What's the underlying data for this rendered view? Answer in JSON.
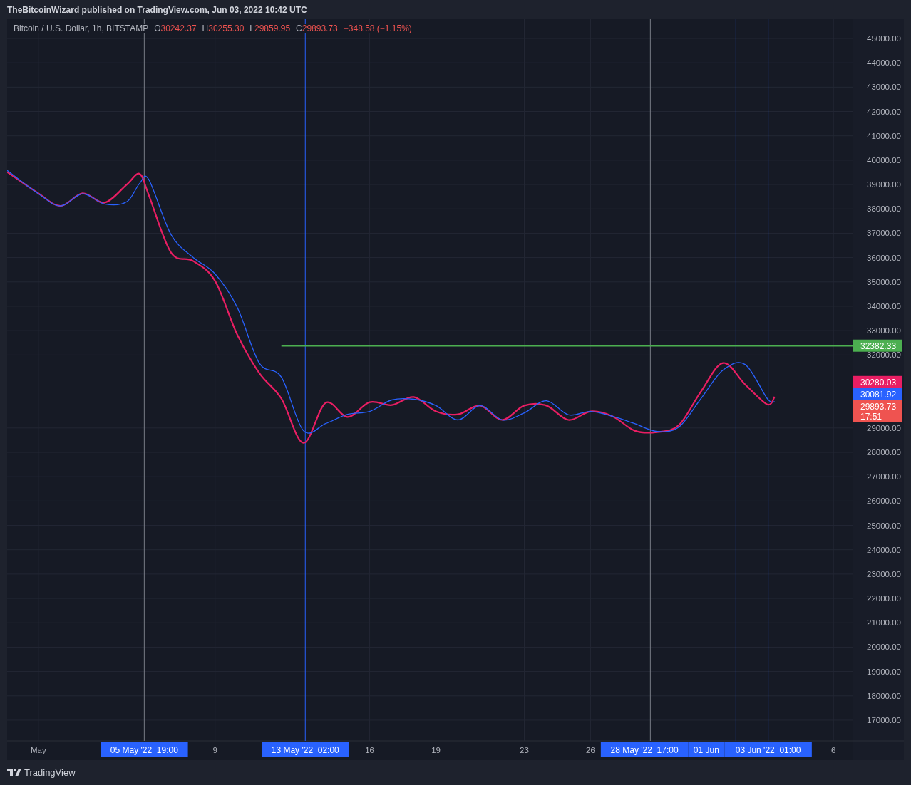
{
  "header": {
    "text": "TheBitcoinWizard published on TradingView.com, Jun 03, 2022 10:42 UTC"
  },
  "legend": {
    "symbol": "Bitcoin / U.S. Dollar, 1h, BITSTAMP",
    "ohlc": [
      {
        "label": "O",
        "value": "30242.37"
      },
      {
        "label": "H",
        "value": "30255.30"
      },
      {
        "label": "L",
        "value": "29859.95"
      },
      {
        "label": "C",
        "value": "29893.73"
      }
    ],
    "change": "−348.58 (−1.15%)"
  },
  "chart_data": {
    "type": "line",
    "grid": true,
    "x": [
      "2022-04-29T14:00",
      "2022-05-01",
      "2022-05-02",
      "2022-05-03",
      "2022-05-04",
      "2022-05-05",
      "2022-05-05T14:00",
      "2022-05-06",
      "2022-05-07",
      "2022-05-08",
      "2022-05-09",
      "2022-05-10",
      "2022-05-11",
      "2022-05-12",
      "2022-05-13",
      "2022-05-14",
      "2022-05-15",
      "2022-05-16",
      "2022-05-17",
      "2022-05-18",
      "2022-05-19",
      "2022-05-20",
      "2022-05-21",
      "2022-05-22",
      "2022-05-23",
      "2022-05-24",
      "2022-05-25",
      "2022-05-26",
      "2022-05-27",
      "2022-05-28",
      "2022-05-29",
      "2022-05-30",
      "2022-05-31",
      "2022-06-01",
      "2022-06-02",
      "2022-06-03",
      "2022-06-03T08:00",
      "2022-06-06T21:00"
    ],
    "xlim": [
      "2022-04-29T14:00",
      "2022-06-09T04:30"
    ],
    "ylim": [
      16150,
      45790
    ],
    "xticks": [
      {
        "value": "2022-05-01",
        "label": "May"
      },
      {
        "value": "2022-05-09",
        "label": "9"
      },
      {
        "value": "2022-05-16",
        "label": "16"
      },
      {
        "value": "2022-05-19",
        "label": "19"
      },
      {
        "value": "2022-05-23",
        "label": "23"
      },
      {
        "value": "2022-05-26",
        "label": "26"
      },
      {
        "value": "2022-06-06",
        "label": "6"
      }
    ],
    "yticks": [
      {
        "value": 45000,
        "label": "45000.00"
      },
      {
        "value": 44000,
        "label": "44000.00"
      },
      {
        "value": 43000,
        "label": "43000.00"
      },
      {
        "value": 42000,
        "label": "42000.00"
      },
      {
        "value": 41000,
        "label": "41000.00"
      },
      {
        "value": 40000,
        "label": "40000.00"
      },
      {
        "value": 39000,
        "label": "39000.00"
      },
      {
        "value": 38000,
        "label": "38000.00"
      },
      {
        "value": 37000,
        "label": "37000.00"
      },
      {
        "value": 36000,
        "label": "36000.00"
      },
      {
        "value": 35000,
        "label": "35000.00"
      },
      {
        "value": 34000,
        "label": "34000.00"
      },
      {
        "value": 33000,
        "label": "33000.00"
      },
      {
        "value": 32000,
        "label": "32000.00"
      },
      {
        "value": 29000,
        "label": "29000.00"
      },
      {
        "value": 28000,
        "label": "28000.00"
      },
      {
        "value": 27000,
        "label": "27000.00"
      },
      {
        "value": 26000,
        "label": "26000.00"
      },
      {
        "value": 25000,
        "label": "25000.00"
      },
      {
        "value": 24000,
        "label": "24000.00"
      },
      {
        "value": 23000,
        "label": "23000.00"
      },
      {
        "value": 22000,
        "label": "22000.00"
      },
      {
        "value": 21000,
        "label": "21000.00"
      },
      {
        "value": 20000,
        "label": "20000.00"
      },
      {
        "value": 19000,
        "label": "19000.00"
      },
      {
        "value": 18000,
        "label": "18000.00"
      },
      {
        "value": 17000,
        "label": "17000.00"
      }
    ],
    "series": [
      {
        "color": "#e91e63",
        "values": [
          39520,
          38640,
          38120,
          38640,
          38260,
          39000,
          39440,
          38560,
          36210,
          35860,
          35040,
          32840,
          31260,
          30210,
          28390,
          30030,
          29450,
          30060,
          29940,
          30270,
          29680,
          29560,
          29920,
          29330,
          29920,
          29920,
          29330,
          29680,
          29480,
          28890,
          28830,
          29120,
          30500,
          31670,
          30790,
          29970,
          30280,
          null
        ]
      },
      {
        "color": "#2962ff",
        "values": [
          39580,
          38620,
          38120,
          38620,
          38200,
          38290,
          39050,
          39200,
          36950,
          36010,
          35330,
          33960,
          31670,
          31090,
          28890,
          29180,
          29560,
          29680,
          30150,
          30180,
          29920,
          29330,
          29920,
          29330,
          29620,
          30120,
          29540,
          29680,
          29480,
          29180,
          28860,
          29040,
          30210,
          31380,
          31610,
          30210,
          30080,
          null
        ]
      },
      {
        "color": "#4caf50",
        "values": [
          null,
          null,
          null,
          null,
          null,
          null,
          null,
          null,
          null,
          null,
          null,
          null,
          null,
          32380,
          32380,
          32380,
          32380,
          32380,
          32380,
          32380,
          32380,
          32380,
          32380,
          32380,
          32380,
          32380,
          32380,
          32380,
          32380,
          32380,
          32380,
          32380,
          32380,
          32380,
          32380,
          32380,
          32380,
          32380
        ]
      }
    ],
    "ref_lines": [
      {
        "axis": "x",
        "value": "2022-05-05T19:00",
        "color": "#787b86",
        "label": "05 May '22  19:00"
      },
      {
        "axis": "x",
        "value": "2022-05-13T02:00",
        "color": "#2962ff",
        "label": "13 May '22  02:00"
      },
      {
        "axis": "x",
        "value": "2022-05-28T17:00",
        "color": "#787b86",
        "label": "28 May '22  17:00"
      },
      {
        "axis": "x",
        "value": "2022-06-01T14:00",
        "color": "#2962ff",
        "label": "01 Jun"
      },
      {
        "axis": "x",
        "value": "2022-06-03T01:00",
        "color": "#2962ff",
        "label": "03 Jun '22  01:00"
      }
    ],
    "annotations": [
      "32382.33",
      "30280.03",
      "30081.92",
      "29893.73"
    ]
  },
  "price_axis": {
    "countdown": "17:51"
  },
  "footer": {
    "brand": "TradingView"
  }
}
